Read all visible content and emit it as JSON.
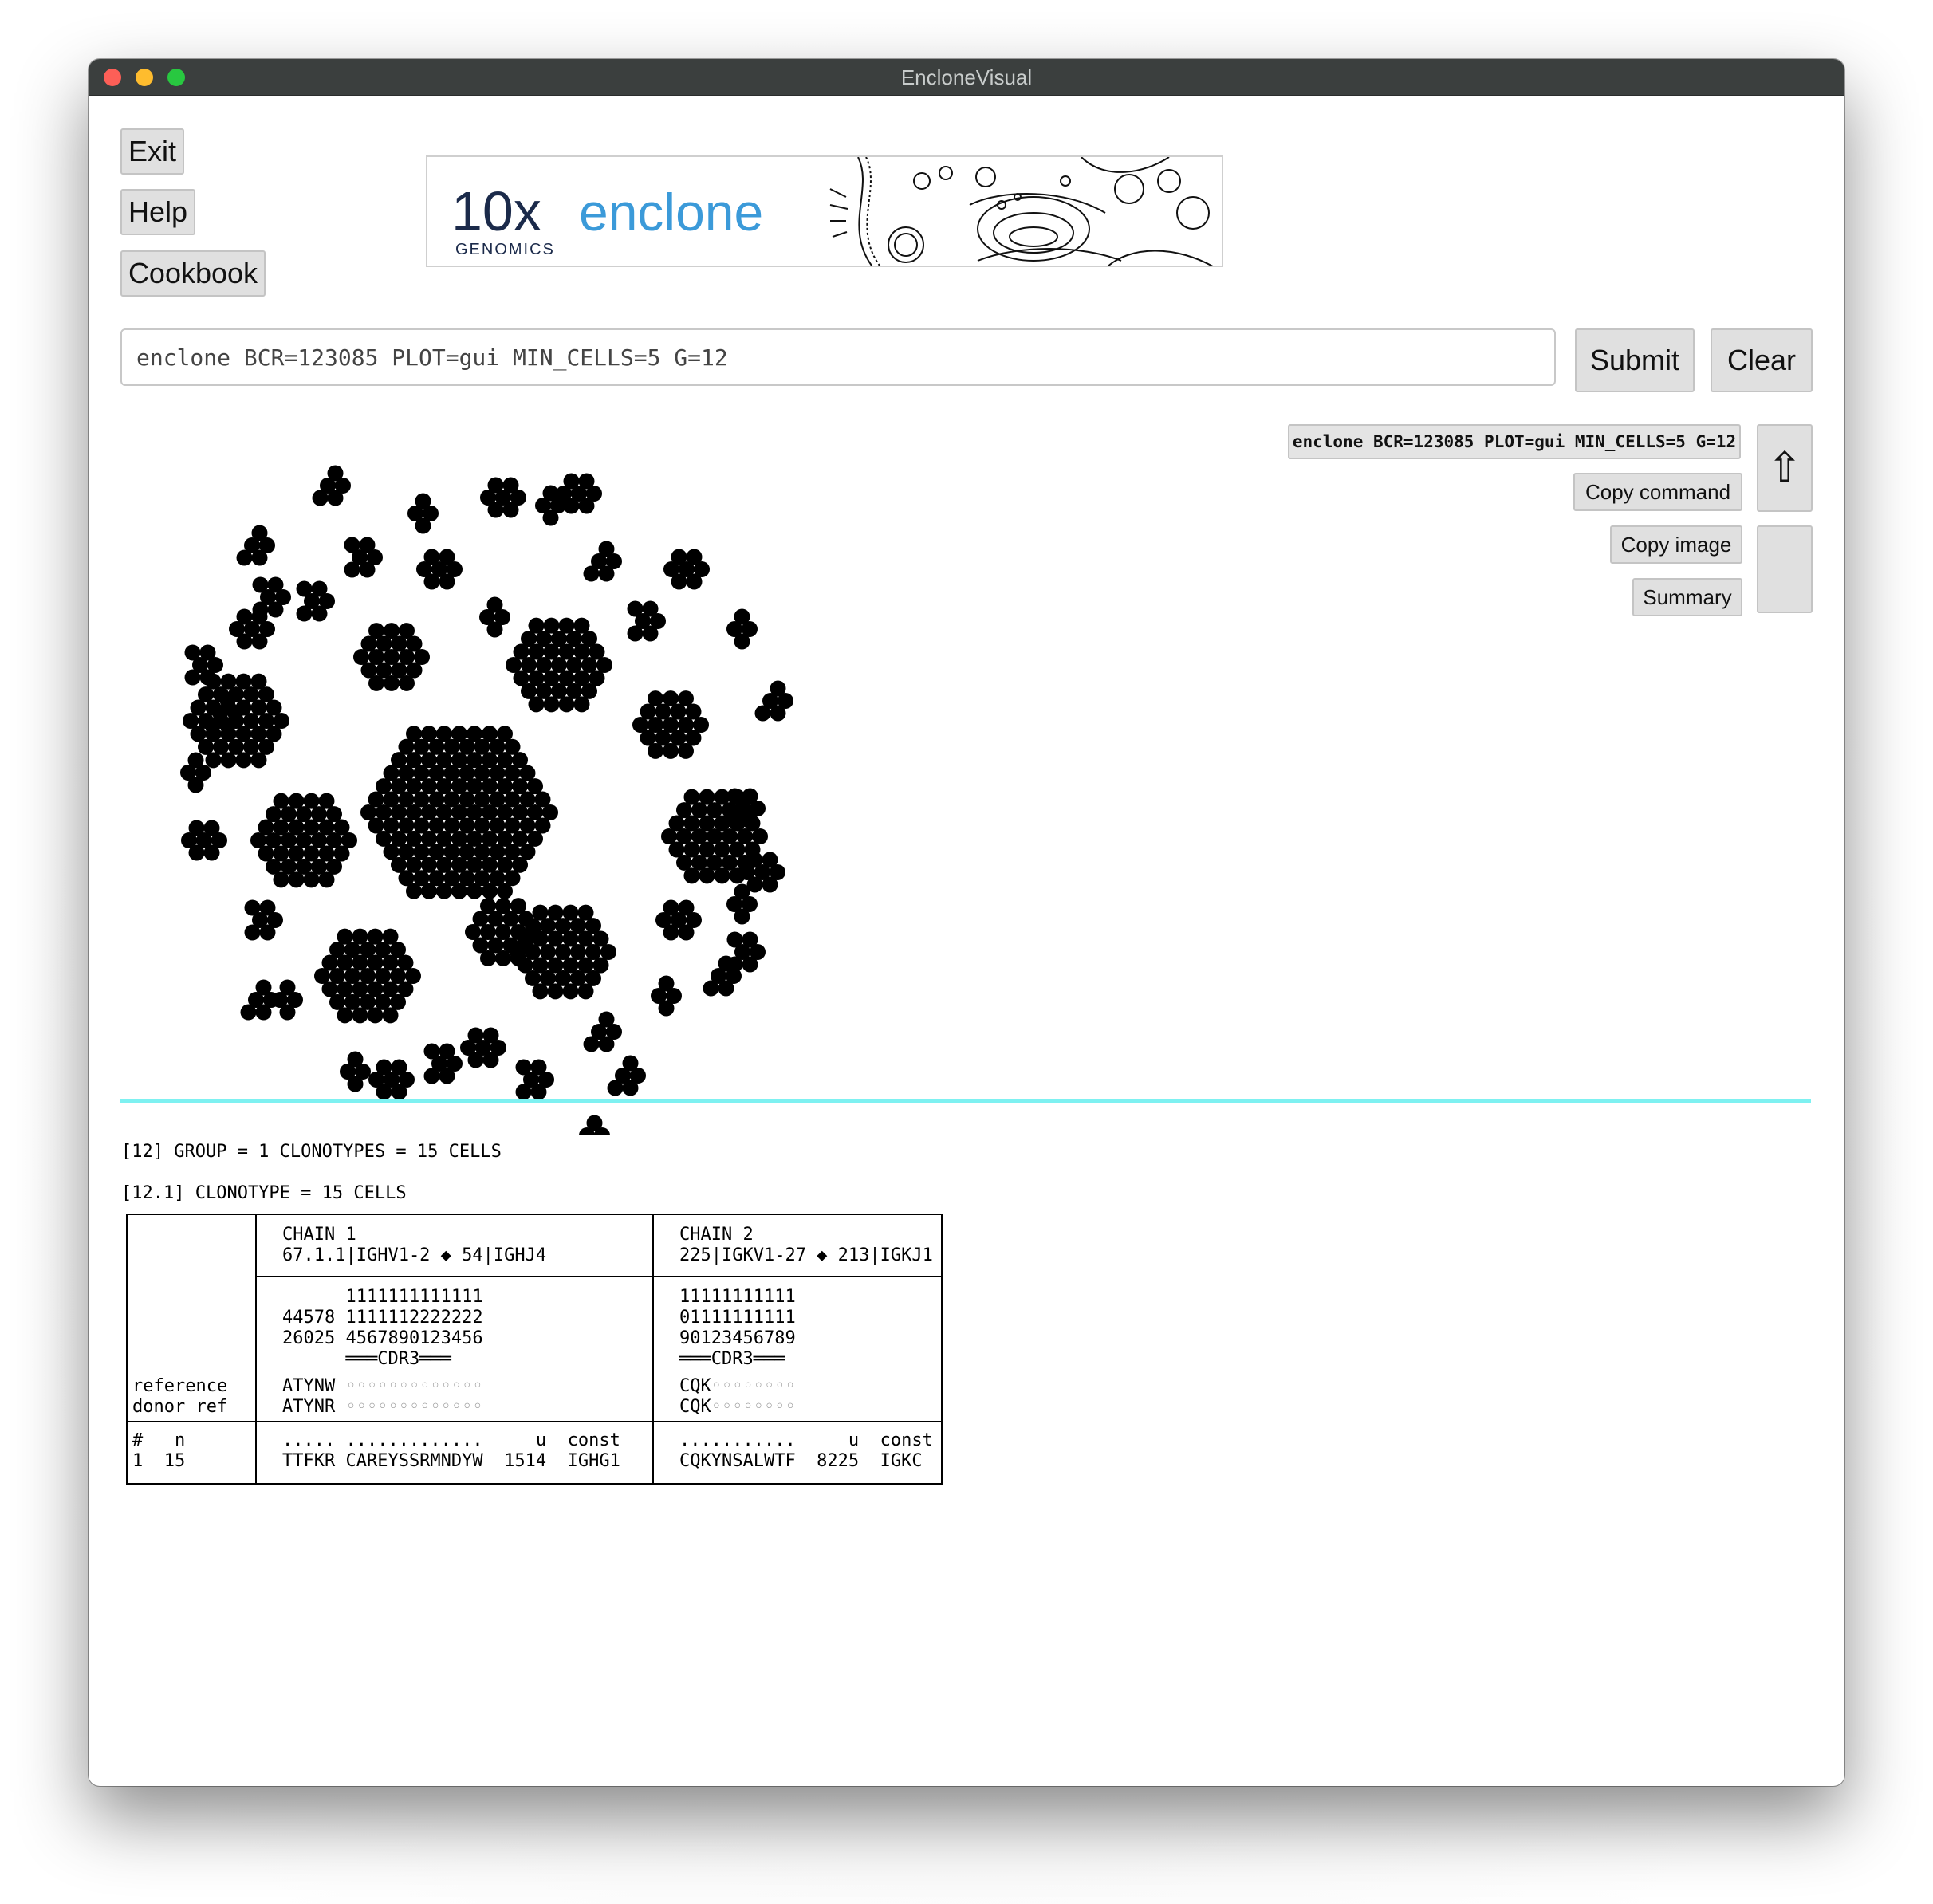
{
  "window": {
    "title": "EncloneVisual"
  },
  "left_buttons": {
    "exit": "Exit",
    "help": "Help",
    "cookbook": "Cookbook"
  },
  "banner": {
    "brand_number": "10x",
    "brand_sub": "GENOMICS",
    "product": "enclone"
  },
  "command": {
    "input_value": "enclone BCR=123085 PLOT=gui MIN_CELLS=5 G=12",
    "submit": "Submit",
    "clear": "Clear",
    "current_command": "enclone BCR=123085 PLOT=gui MIN_CELLS=5 G=12"
  },
  "side_buttons": {
    "up_arrow": "⇧",
    "copy_command": "Copy command",
    "copy_image": "Copy image",
    "summary": "Summary"
  },
  "colors": {
    "divider": "#7ef1f1",
    "dot": "#000000",
    "accent_blue": "#3b9ad9"
  },
  "results": {
    "group_line": "[12] GROUP = 1 CLONOTYPES = 15 CELLS",
    "clonotype_line": "[12.1] CLONOTYPE = 15 CELLS",
    "chain1": {
      "header": "CHAIN 1",
      "genes": "67.1.1|IGHV1-2 ◆ 54|IGHJ4",
      "pos_line1": "      1111111111111",
      "pos_line2": "44578 1111112222222",
      "pos_line3": "26025 4567890123456",
      "cdr3_label": "      ═══CDR3═══",
      "ref_prefix": "ATYNW",
      "ref_dots": " ◦◦◦◦◦◦◦◦◦◦◦◦◦",
      "donor_prefix": "ATYNR",
      "donor_dots": " ◦◦◦◦◦◦◦◦◦◦◦◦◦",
      "col_header": "..... .............     u  const",
      "row_value": "TTFKR CAREYSSRMNDYW  1514  IGHG1"
    },
    "chain2": {
      "header": "CHAIN 2",
      "genes": "225|IGKV1-27 ◆ 213|IGKJ1",
      "pos_line1": "11111111111",
      "pos_line2": "01111111111",
      "pos_line3": "90123456789",
      "cdr3_label": "═══CDR3═══",
      "ref_prefix": "CQK",
      "ref_dots": "◦◦◦◦◦◦◦◦",
      "donor_prefix": "CQK",
      "donor_dots": "◦◦◦◦◦◦◦◦",
      "col_header": "...........     u  const",
      "row_value": "CQKYNSALWTF  8225  IGKC"
    },
    "left_col": {
      "reference": "reference",
      "donor_ref": "donor ref",
      "header": "#   n",
      "row": "1  15"
    }
  }
}
